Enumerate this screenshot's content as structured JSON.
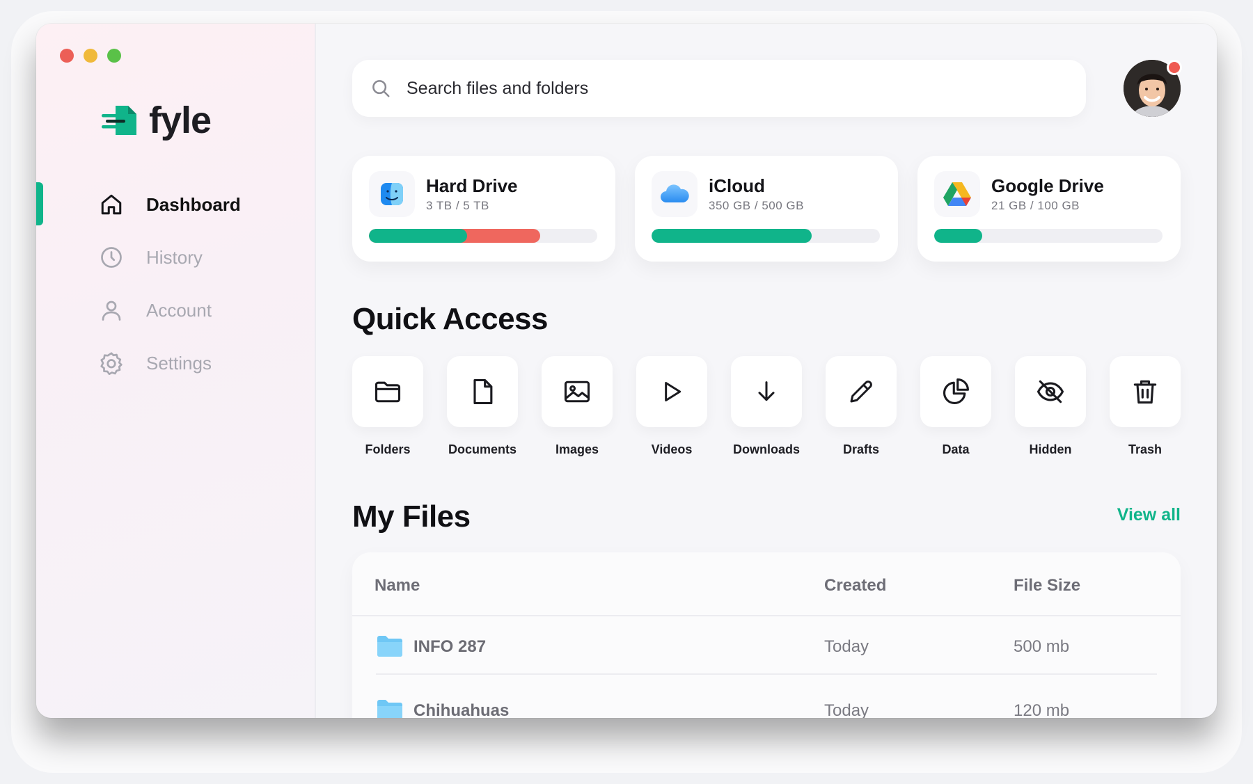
{
  "app": {
    "name": "fyle"
  },
  "sidebar": {
    "items": [
      {
        "label": "Dashboard",
        "icon": "home-icon",
        "active": true
      },
      {
        "label": "History",
        "icon": "clock-icon",
        "active": false
      },
      {
        "label": "Account",
        "icon": "user-icon",
        "active": false
      },
      {
        "label": "Settings",
        "icon": "gear-icon",
        "active": false
      }
    ]
  },
  "search": {
    "placeholder": "Search files and folders"
  },
  "storage": [
    {
      "name": "Hard Drive",
      "usage": "3 TB / 5 TB",
      "icon": "finder-icon",
      "segments": [
        0.43,
        0.32
      ],
      "segment_colors": [
        "#10b48a",
        "#ef675e"
      ]
    },
    {
      "name": "iCloud",
      "usage": "350 GB / 500 GB",
      "icon": "icloud-icon",
      "segments": [
        0.7
      ],
      "segment_colors": [
        "#10b48a"
      ]
    },
    {
      "name": "Google Drive",
      "usage": "21 GB / 100 GB",
      "icon": "google-drive-icon",
      "segments": [
        0.21
      ],
      "segment_colors": [
        "#10b48a"
      ]
    }
  ],
  "quick_access": {
    "title": "Quick Access",
    "items": [
      {
        "label": "Folders",
        "icon": "folder-icon"
      },
      {
        "label": "Documents",
        "icon": "document-icon"
      },
      {
        "label": "Images",
        "icon": "image-icon"
      },
      {
        "label": "Videos",
        "icon": "play-icon"
      },
      {
        "label": "Downloads",
        "icon": "download-icon"
      },
      {
        "label": "Drafts",
        "icon": "pencil-icon"
      },
      {
        "label": "Data",
        "icon": "pie-chart-icon"
      },
      {
        "label": "Hidden",
        "icon": "eye-off-icon"
      },
      {
        "label": "Trash",
        "icon": "trash-icon"
      }
    ]
  },
  "my_files": {
    "title": "My Files",
    "view_all": "View all",
    "columns": [
      "Name",
      "Created",
      "File Size"
    ],
    "rows": [
      {
        "name": "INFO 287",
        "created": "Today",
        "size": "500 mb"
      },
      {
        "name": "Chihuahuas",
        "created": "Today",
        "size": "120 mb"
      }
    ]
  },
  "colors": {
    "accent": "#10b48a",
    "danger": "#ef675e",
    "folder": "#6fc7f5"
  }
}
